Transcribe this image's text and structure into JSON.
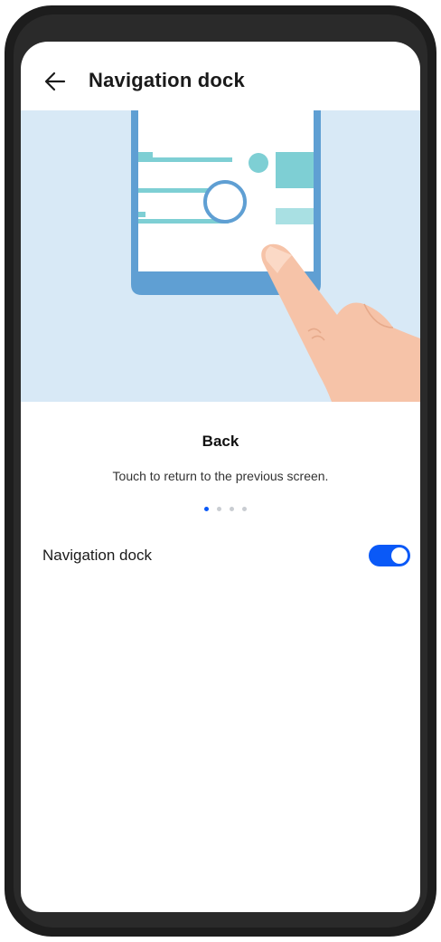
{
  "header": {
    "title": "Navigation dock",
    "back_icon": "arrow-left-icon"
  },
  "illustration": {
    "description_icon": "phone-back-gesture-illustration",
    "colors": {
      "background": "#d8e9f6",
      "phone_frame": "#5f9fd3",
      "accent": "#7ecfd4",
      "finger": "#f6c3a8"
    }
  },
  "feature": {
    "name": "Back",
    "description": "Touch to return to the previous screen."
  },
  "pager": {
    "count": 4,
    "active_index": 0,
    "active_color": "#0a59f7"
  },
  "settings": {
    "navigation_dock": {
      "label": "Navigation dock",
      "enabled": true
    }
  },
  "colors": {
    "accent": "#0a59f7"
  }
}
